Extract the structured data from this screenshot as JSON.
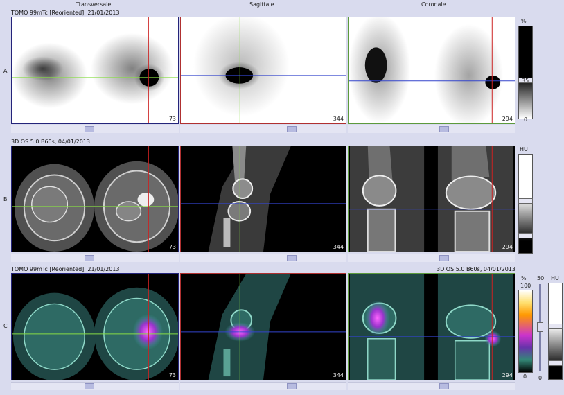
{
  "columns": {
    "transversale": "Transversale",
    "sagittale": "Sagittale",
    "coronale": "Coronale"
  },
  "rows": [
    {
      "label": "A",
      "info": "TOMO 99mTc [Reoriented], 21/01/2013",
      "info_right": "",
      "slices": {
        "transversale": "73",
        "sagittale": "344",
        "coronale": "294"
      }
    },
    {
      "label": "B",
      "info": "3D OS 5.0 B60s, 04/01/2013",
      "info_right": "",
      "slices": {
        "transversale": "73",
        "sagittale": "344",
        "coronale": "294"
      }
    },
    {
      "label": "C",
      "info": "TOMO 99mTc [Reoriented], 21/01/2013",
      "info_right": "3D OS 5.0 B60s, 04/01/2013",
      "slices": {
        "transversale": "73",
        "sagittale": "344",
        "coronale": "294"
      }
    }
  ],
  "colorbars": {
    "a": {
      "unit": "%",
      "max": "",
      "mid": "35",
      "min": "0"
    },
    "b": {
      "unit": "HU"
    },
    "c": {
      "unit": "%",
      "max": "100",
      "min": "0",
      "slider_value": "50",
      "ct_unit": "HU"
    }
  },
  "colors": {
    "background": "#d9dbee",
    "crosshair_vertical": "#cc2222",
    "crosshair_horizontal_transversale": "#88dd44",
    "crosshair_horizontal_other": "#3344cc",
    "crosshair_vertical_sagittale": "#88dd44"
  }
}
